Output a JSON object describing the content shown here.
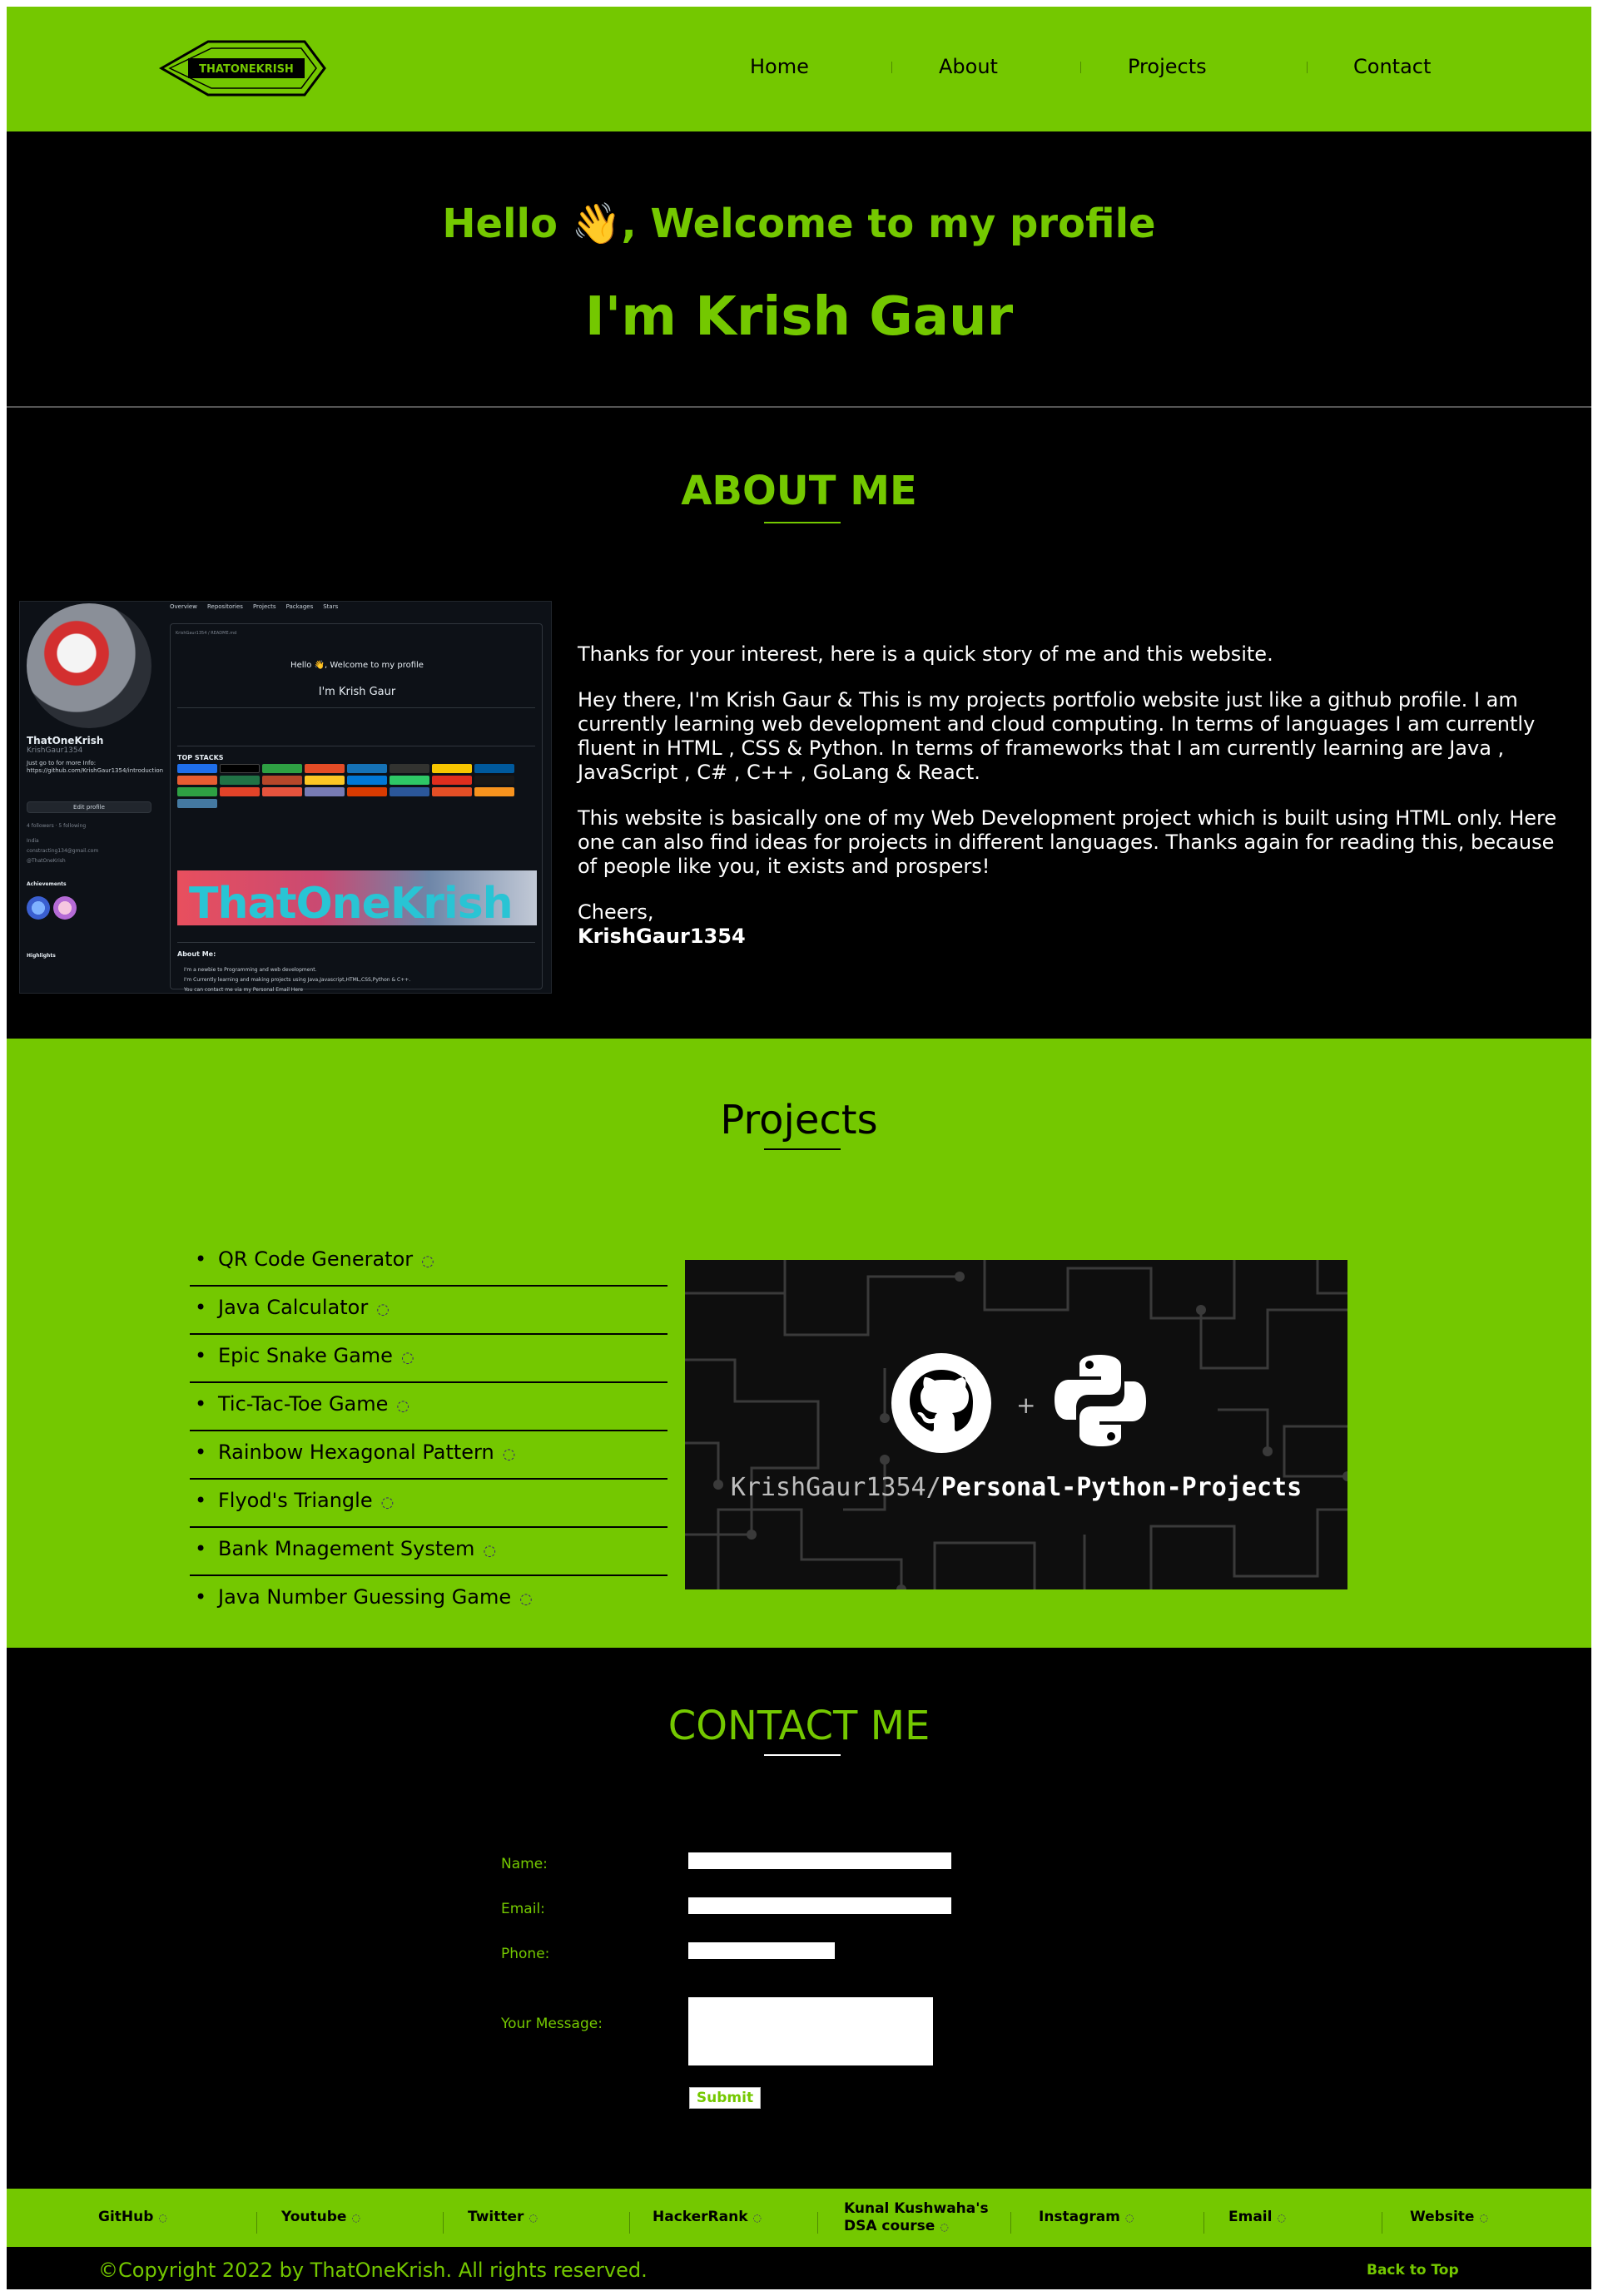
{
  "logo": {
    "text": "THATONEKRISH"
  },
  "nav": {
    "items": [
      "Home",
      "About",
      "Projects",
      "Contact"
    ]
  },
  "hero": {
    "greeting": "Hello 👋, Welcome to my profile",
    "name": "I'm Krish Gaur"
  },
  "about": {
    "title": "ABOUT ME",
    "paragraphs": [
      "Thanks for your interest, here is a quick story of me and this website.",
      "Hey there, I'm Krish Gaur & This is my projects portfolio website just like a github profile. I am currently learning web development and cloud computing. In terms of languages I am currently fluent in HTML , CSS & Python. In terms of frameworks that I am currently learning are Java , JavaScript , C# , C++ , GoLang & React.",
      "This website is basically one of my Web Development project which is built using HTML only. Here one can also find ideas for projects in different languages. Thanks again for reading this, because of people like you, it exists and prospers!"
    ],
    "closing": "Cheers,",
    "signature": "KrishGaur1354",
    "screenshot": {
      "profile_name": "ThatOneKrish",
      "profile_handle": "KrishGaur1354",
      "bio": "Just go to for more Info: https://github.com/KrishGaur1354/introduction",
      "edit_button": "Edit profile",
      "followers": "4 followers · 5 following",
      "location": "India",
      "email": "constracting134@gmail.com",
      "twitter": "@ThatOneKrish",
      "achievements_label": "Achievements",
      "highlights_label": "Highlights",
      "tabs": [
        "Overview",
        "Repositories",
        "Projects",
        "Packages",
        "Stars"
      ],
      "path": "KrishGaur1354 / README.md",
      "readme_hello": "Hello 👋, Welcome to my profile",
      "readme_name": "I'm Krish Gaur",
      "top_stacks": "TOP STACKS",
      "banner_text": "ThatOneKrish",
      "about_heading": "About Me:",
      "about_items": [
        "I'm a newbie to Programming and web development.",
        "I'm Currently learning and making projects using Java,Javascript,HTML,CSS,Python & C++.",
        "You can contact me via my Personal Email Here"
      ]
    }
  },
  "projects": {
    "title": "Projects",
    "items": [
      "QR Code Generator",
      "Java Calculator",
      "Epic Snake Game",
      "Tic-Tac-Toe Game",
      "Rainbow Hexagonal Pattern",
      "Flyod's Triangle",
      "Bank Mnagement System",
      "Java Number Guessing Game"
    ],
    "banner_owner": "KrishGaur1354/",
    "banner_repo": "Personal-Python-Projects"
  },
  "contact": {
    "title": "CONTACT ME",
    "name_label": "Name:",
    "email_label": "Email:",
    "phone_label": "Phone:",
    "message_label": "Your Message:",
    "submit_label": "Submit"
  },
  "footer": {
    "links": [
      "GitHub",
      "Youtube",
      "Twitter",
      "HackerRank",
      "Kunal Kushwaha's",
      "DSA course",
      "Instagram",
      "Email",
      "Website"
    ],
    "copyright": "©Copyright 2022 by ThatOneKrish. All rights reserved.",
    "back_to_top": "Back to Top"
  },
  "colors": {
    "accent_green": "#74c800",
    "background": "#000000",
    "spinner": "#3a2a6a"
  },
  "icons": [
    "logo-badge",
    "loading-spinner-icon",
    "github-octocat-icon",
    "python-logo-icon",
    "plus-icon"
  ]
}
